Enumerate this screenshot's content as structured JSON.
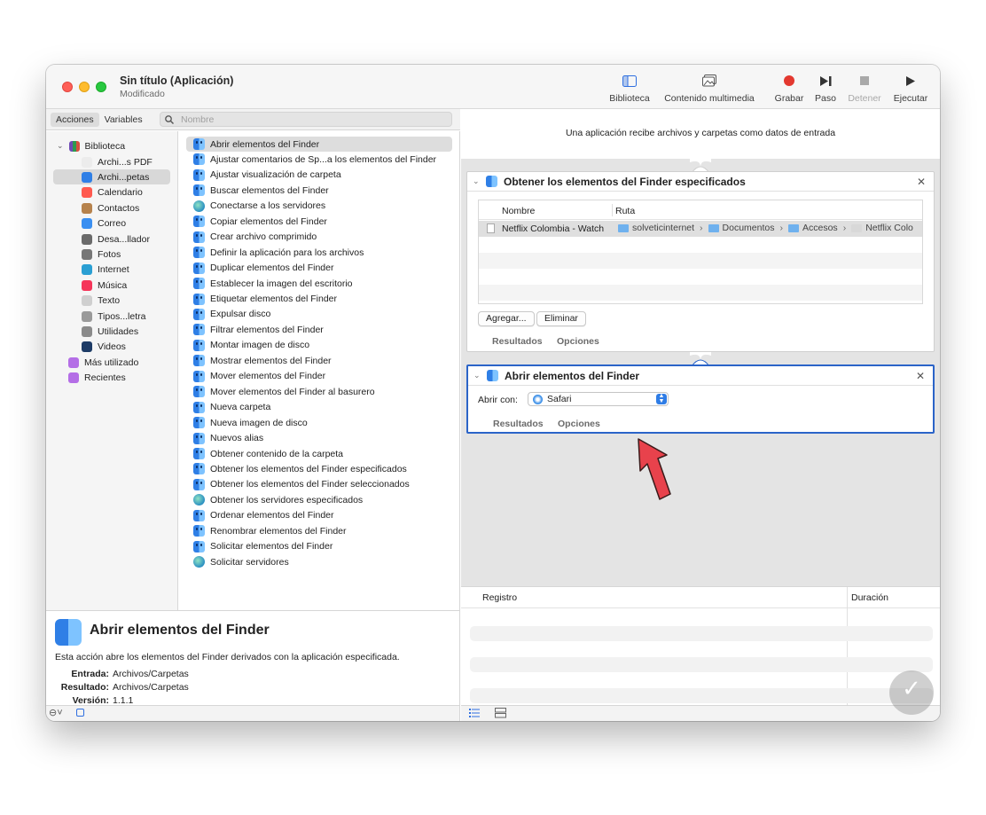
{
  "window": {
    "title": "Sin título (Aplicación)",
    "subtitle": "Modificado"
  },
  "toolbar": {
    "library": "Biblioteca",
    "media": "Contenido multimedia",
    "record": "Grabar",
    "step": "Paso",
    "stop": "Detener",
    "run": "Ejecutar"
  },
  "tabs": {
    "actions": "Acciones",
    "variables": "Variables"
  },
  "search": {
    "placeholder": "Nombre"
  },
  "library": {
    "root": "Biblioteca",
    "items": [
      {
        "label": "Archi...s PDF",
        "icon": "pdf-icon",
        "color": "#ececec"
      },
      {
        "label": "Archi...petas",
        "icon": "finder-icon",
        "color": "#2f7fe6"
      },
      {
        "label": "Calendario",
        "icon": "calendar-icon",
        "color": "#ff5a4f"
      },
      {
        "label": "Contactos",
        "icon": "contacts-icon",
        "color": "#b6824c"
      },
      {
        "label": "Correo",
        "icon": "mail-icon",
        "color": "#3a8ff1"
      },
      {
        "label": "Desa...llador",
        "icon": "developer-icon",
        "color": "#6a6a6a"
      },
      {
        "label": "Fotos",
        "icon": "photos-icon",
        "color": "#777777"
      },
      {
        "label": "Internet",
        "icon": "globe-icon",
        "color": "#2a9fd3"
      },
      {
        "label": "Música",
        "icon": "music-icon",
        "color": "#f5365a"
      },
      {
        "label": "Texto",
        "icon": "text-icon",
        "color": "#cfcfcf"
      },
      {
        "label": "Tipos...letra",
        "icon": "font-icon",
        "color": "#9a9a9a"
      },
      {
        "label": "Utilidades",
        "icon": "utilities-icon",
        "color": "#8a8a8a"
      },
      {
        "label": "Videos",
        "icon": "video-icon",
        "color": "#1d3b66"
      }
    ],
    "extra": [
      {
        "label": "Más utilizado",
        "icon": "smart-folder-icon",
        "color": "#b46ee6"
      },
      {
        "label": "Recientes",
        "icon": "smart-folder-icon",
        "color": "#b46ee6"
      }
    ]
  },
  "actions": [
    {
      "label": "Abrir elementos del Finder",
      "icon": "finder"
    },
    {
      "label": "Ajustar comentarios de Sp...a los elementos del Finder",
      "icon": "finder"
    },
    {
      "label": "Ajustar visualización de carpeta",
      "icon": "finder"
    },
    {
      "label": "Buscar elementos del Finder",
      "icon": "finder"
    },
    {
      "label": "Conectarse a los servidores",
      "icon": "globe"
    },
    {
      "label": "Copiar elementos del Finder",
      "icon": "finder"
    },
    {
      "label": "Crear archivo comprimido",
      "icon": "finder"
    },
    {
      "label": "Definir la aplicación para los archivos",
      "icon": "finder"
    },
    {
      "label": "Duplicar elementos del Finder",
      "icon": "finder"
    },
    {
      "label": "Establecer la imagen del escritorio",
      "icon": "finder"
    },
    {
      "label": "Etiquetar elementos del Finder",
      "icon": "finder"
    },
    {
      "label": "Expulsar disco",
      "icon": "finder"
    },
    {
      "label": "Filtrar elementos del Finder",
      "icon": "finder"
    },
    {
      "label": "Montar imagen de disco",
      "icon": "finder"
    },
    {
      "label": "Mostrar elementos del Finder",
      "icon": "finder"
    },
    {
      "label": "Mover elementos del Finder",
      "icon": "finder"
    },
    {
      "label": "Mover elementos del Finder al basurero",
      "icon": "finder"
    },
    {
      "label": "Nueva carpeta",
      "icon": "finder"
    },
    {
      "label": "Nueva imagen de disco",
      "icon": "finder"
    },
    {
      "label": "Nuevos alias",
      "icon": "finder"
    },
    {
      "label": "Obtener contenido de la carpeta",
      "icon": "finder"
    },
    {
      "label": "Obtener los elementos del Finder especificados",
      "icon": "finder"
    },
    {
      "label": "Obtener los elementos del Finder seleccionados",
      "icon": "finder"
    },
    {
      "label": "Obtener los servidores especificados",
      "icon": "globe"
    },
    {
      "label": "Ordenar elementos del Finder",
      "icon": "finder"
    },
    {
      "label": "Renombrar elementos del Finder",
      "icon": "finder"
    },
    {
      "label": "Solicitar elementos del Finder",
      "icon": "finder"
    },
    {
      "label": "Solicitar servidores",
      "icon": "globe"
    }
  ],
  "description": {
    "title": "Abrir elementos del Finder",
    "text": "Esta acción abre los elementos del Finder derivados con la aplicación especificada.",
    "input_label": "Entrada:",
    "input_value": "Archivos/Carpetas",
    "result_label": "Resultado:",
    "result_value": "Archivos/Carpetas",
    "version_label": "Versión:",
    "version_value": "1.1.1"
  },
  "workflow": {
    "header": "Una aplicación recibe archivos y carpetas como datos de entrada",
    "card1": {
      "title": "Obtener los elementos del Finder especificados",
      "col_name": "Nombre",
      "col_path": "Ruta",
      "row_name": "Netflix Colombia - Watch",
      "path": [
        "solveticinternet",
        "Documentos",
        "Accesos",
        "Netflix Colo"
      ],
      "add": "Agregar...",
      "remove": "Eliminar",
      "results": "Resultados",
      "options": "Opciones"
    },
    "card2": {
      "title": "Abrir elementos del Finder",
      "open_with_label": "Abrir con:",
      "app": "Safari",
      "results": "Resultados",
      "options": "Opciones"
    }
  },
  "log": {
    "col_log": "Registro",
    "col_duration": "Duración"
  },
  "colors": {
    "accent": "#2b64c8",
    "arrow": "#e8424c"
  }
}
